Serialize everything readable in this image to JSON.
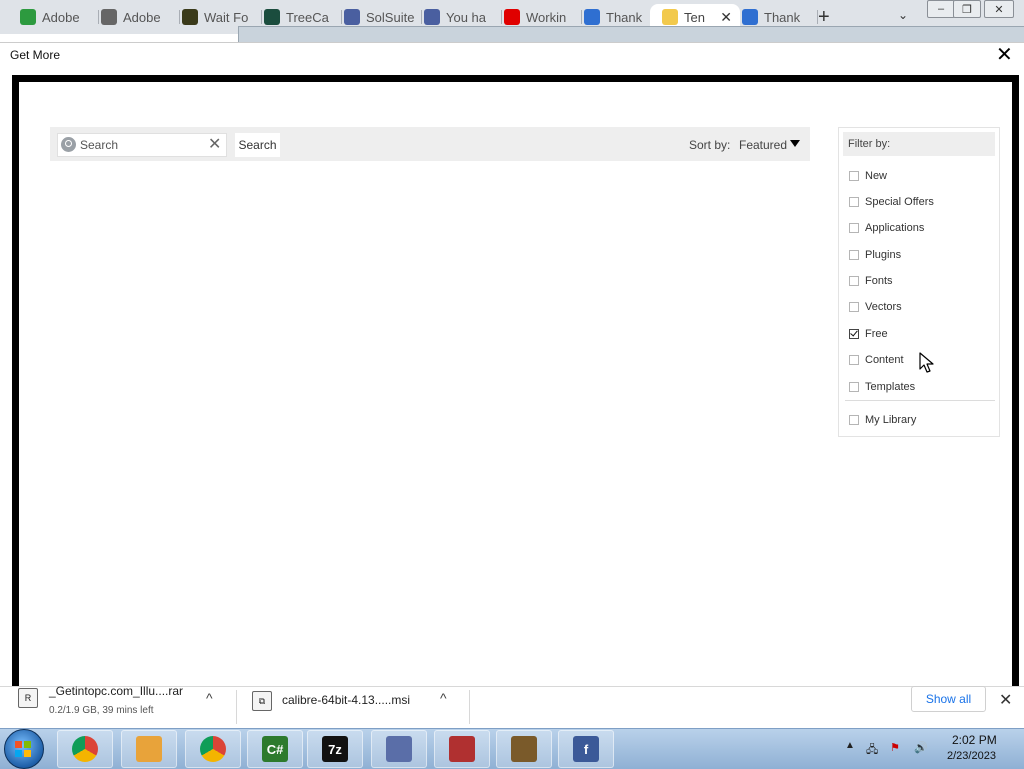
{
  "browser": {
    "tabs": [
      {
        "label": "Adobe",
        "icon": "adobe-green-icon",
        "color": "#2d9a3f"
      },
      {
        "label": "Adobe",
        "icon": "dollar-circle-icon",
        "color": "#666666"
      },
      {
        "label": "Wait Fo",
        "icon": "g-letter-icon",
        "color": "#3a3a1a"
      },
      {
        "label": "TreeCa",
        "icon": "treecap-icon",
        "color": "#1b4d3e"
      },
      {
        "label": "SolSuite",
        "icon": "solsuite-icon",
        "color": "#4a5fa0"
      },
      {
        "label": "You ha",
        "icon": "solsuite-icon",
        "color": "#4a5fa0"
      },
      {
        "label": "Workin",
        "icon": "youtube-icon",
        "color": "#e00000"
      },
      {
        "label": "Thank",
        "icon": "balloon-icon",
        "color": "#2f6fd1"
      },
      {
        "label": "Ten",
        "icon": "mail-icon",
        "color": "#f2c94c",
        "active": true
      },
      {
        "label": "Thank",
        "icon": "balloon-icon",
        "color": "#2f6fd1"
      }
    ],
    "new_tab_symbol": "+",
    "tab_menu_symbol": "⌄",
    "close_tab_symbol": "✕"
  },
  "window_controls": {
    "minimize": "–",
    "maximize": "❐",
    "close": "✕"
  },
  "dialog": {
    "title": "Get More",
    "close_symbol": "✕"
  },
  "toolbar": {
    "search_placeholder": "Search",
    "clear_symbol": "✕",
    "search_button": "Search",
    "sort_label": "Sort by:",
    "sort_value": "Featured"
  },
  "filter": {
    "title": "Filter by:",
    "items": [
      {
        "label": "New",
        "checked": false
      },
      {
        "label": "Special Offers",
        "checked": false
      },
      {
        "label": "Applications",
        "checked": false
      },
      {
        "label": "Plugins",
        "checked": false
      },
      {
        "label": "Fonts",
        "checked": false
      },
      {
        "label": "Vectors",
        "checked": false
      },
      {
        "label": "Free",
        "checked": true
      },
      {
        "label": "Content",
        "checked": false
      },
      {
        "label": "Templates",
        "checked": false
      }
    ],
    "library": {
      "label": "My Library",
      "checked": false
    }
  },
  "downloads": {
    "items": [
      {
        "name": "_Getintopc.com_Illu....rar",
        "status": "0.2/1.9 GB, 39 mins left",
        "icon": "rar-archive-icon"
      },
      {
        "name": "calibre-64bit-4.13.....msi",
        "status": "",
        "icon": "msi-installer-icon"
      }
    ],
    "chevron_symbol": "^",
    "show_all": "Show all",
    "close_symbol": "✕"
  },
  "taskbar": {
    "apps": [
      {
        "name": "chrome-pinned",
        "label": ""
      },
      {
        "name": "media-player",
        "label": ""
      },
      {
        "name": "chrome",
        "label": ""
      },
      {
        "name": "csharp",
        "label": "C#"
      },
      {
        "name": "7zip",
        "label": "7z"
      },
      {
        "name": "installer",
        "label": ""
      },
      {
        "name": "solitaire",
        "label": ""
      },
      {
        "name": "calibre",
        "label": ""
      },
      {
        "name": "facebook",
        "label": "f"
      }
    ],
    "clock_time": "2:02 PM",
    "clock_date": "2/23/2023"
  }
}
